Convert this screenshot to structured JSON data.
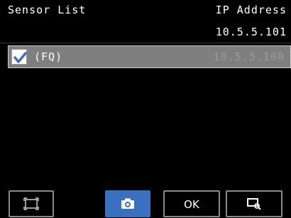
{
  "header": {
    "title": "Sensor List",
    "column_label": "IP Address"
  },
  "local": {
    "ip": "10.5.5.101"
  },
  "sensors": [
    {
      "name": "(FQ)",
      "ip": "10.5.5.100",
      "checked": true
    }
  ],
  "toolbar": {
    "frame_icon": "frame-icon",
    "camera_icon": "camera-icon",
    "ok_label": "OK",
    "search_icon": "monitor-search-icon"
  },
  "colors": {
    "accent": "#3b6fc0",
    "row_bg": "#7f7f7f"
  }
}
